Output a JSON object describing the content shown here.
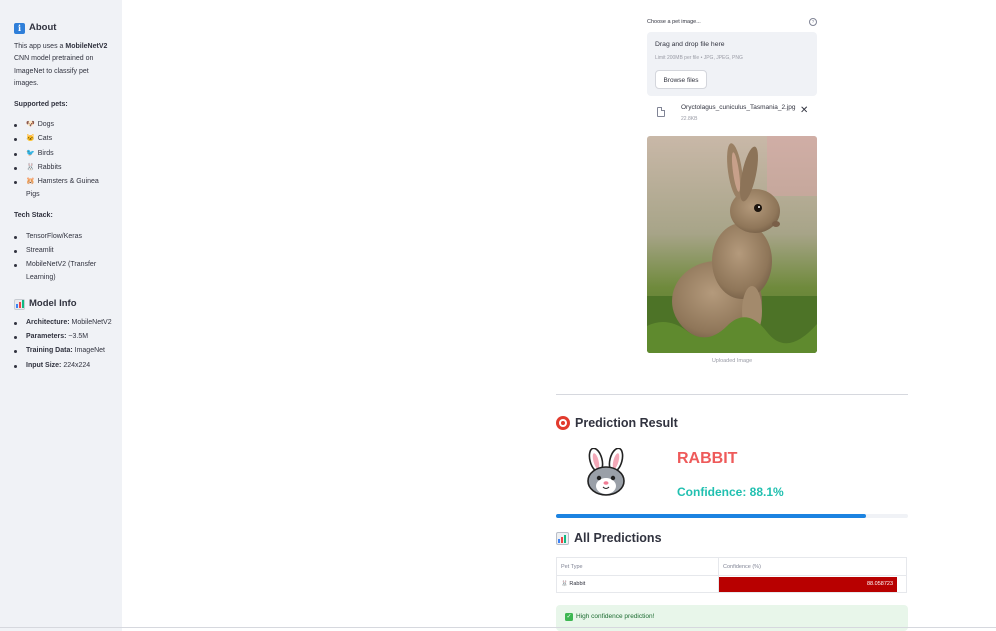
{
  "sidebar": {
    "about": {
      "icon": "info-icon",
      "title": "About",
      "intro_pre": "This app uses a ",
      "intro_bold": "MobileNetV2",
      "intro_post": " CNN model pretrained on ImageNet to classify pet images."
    },
    "supported_title": "Supported pets:",
    "pets": [
      {
        "emoji": "🐶",
        "label": "Dogs"
      },
      {
        "emoji": "🐱",
        "label": "Cats"
      },
      {
        "emoji": "🐦",
        "label": "Birds"
      },
      {
        "emoji": "🐰",
        "label": "Rabbits"
      },
      {
        "emoji": "🐹",
        "label": "Hamsters & Guinea Pigs"
      }
    ],
    "tech_title": "Tech Stack:",
    "tech": [
      "TensorFlow/Keras",
      "Streamlit",
      "MobileNetV2 (Transfer Learning)"
    ],
    "model_info": {
      "icon": "bar-chart-icon",
      "title": "Model Info",
      "items": [
        {
          "key": "Architecture:",
          "value": "MobileNetV2"
        },
        {
          "key": "Parameters:",
          "value": "~3.5M"
        },
        {
          "key": "Training Data:",
          "value": "ImageNet"
        },
        {
          "key": "Input Size:",
          "value": "224x224"
        }
      ]
    }
  },
  "uploader": {
    "label": "Choose a pet image...",
    "drop_title": "Drag and drop file here",
    "limit": "Limit 200MB per file • JPG, JPEG, PNG",
    "browse": "Browse files",
    "file_name": "Oryctolagus_cuniculus_Tasmania_2.jpg",
    "file_size": "22.8KB",
    "image_caption": "Uploaded Image"
  },
  "prediction": {
    "title": "Prediction Result",
    "label": "RABBIT",
    "confidence_text": "Confidence: 88.1%",
    "confidence": 0.881
  },
  "all_predictions": {
    "title": "All Predictions",
    "columns": [
      "Pet Type",
      "Confidence (%)"
    ],
    "rows": [
      {
        "pet": "🐰 Rabbit",
        "confidence": "88.058723"
      }
    ]
  },
  "status": {
    "message": "High confidence prediction!"
  },
  "colors": {
    "accent": "#ee5a5a",
    "confidence": "#21c0b0",
    "progress": "#1c83e1",
    "table_bar": "#b80000",
    "success_bg": "#e8f6ea"
  }
}
